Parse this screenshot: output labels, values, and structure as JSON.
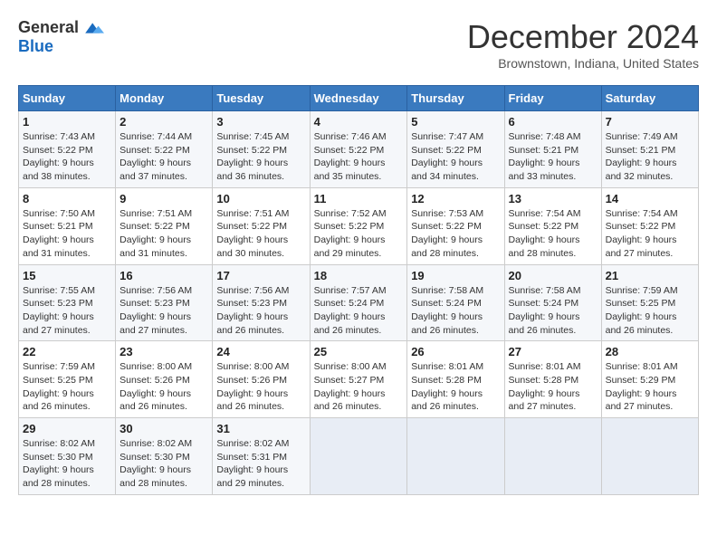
{
  "header": {
    "logo_general": "General",
    "logo_blue": "Blue",
    "month_title": "December 2024",
    "location": "Brownstown, Indiana, United States"
  },
  "weekdays": [
    "Sunday",
    "Monday",
    "Tuesday",
    "Wednesday",
    "Thursday",
    "Friday",
    "Saturday"
  ],
  "weeks": [
    [
      {
        "day": "1",
        "sunrise": "7:43 AM",
        "sunset": "5:22 PM",
        "daylight": "9 hours and 38 minutes."
      },
      {
        "day": "2",
        "sunrise": "7:44 AM",
        "sunset": "5:22 PM",
        "daylight": "9 hours and 37 minutes."
      },
      {
        "day": "3",
        "sunrise": "7:45 AM",
        "sunset": "5:22 PM",
        "daylight": "9 hours and 36 minutes."
      },
      {
        "day": "4",
        "sunrise": "7:46 AM",
        "sunset": "5:22 PM",
        "daylight": "9 hours and 35 minutes."
      },
      {
        "day": "5",
        "sunrise": "7:47 AM",
        "sunset": "5:22 PM",
        "daylight": "9 hours and 34 minutes."
      },
      {
        "day": "6",
        "sunrise": "7:48 AM",
        "sunset": "5:21 PM",
        "daylight": "9 hours and 33 minutes."
      },
      {
        "day": "7",
        "sunrise": "7:49 AM",
        "sunset": "5:21 PM",
        "daylight": "9 hours and 32 minutes."
      }
    ],
    [
      {
        "day": "8",
        "sunrise": "7:50 AM",
        "sunset": "5:21 PM",
        "daylight": "9 hours and 31 minutes."
      },
      {
        "day": "9",
        "sunrise": "7:51 AM",
        "sunset": "5:22 PM",
        "daylight": "9 hours and 31 minutes."
      },
      {
        "day": "10",
        "sunrise": "7:51 AM",
        "sunset": "5:22 PM",
        "daylight": "9 hours and 30 minutes."
      },
      {
        "day": "11",
        "sunrise": "7:52 AM",
        "sunset": "5:22 PM",
        "daylight": "9 hours and 29 minutes."
      },
      {
        "day": "12",
        "sunrise": "7:53 AM",
        "sunset": "5:22 PM",
        "daylight": "9 hours and 28 minutes."
      },
      {
        "day": "13",
        "sunrise": "7:54 AM",
        "sunset": "5:22 PM",
        "daylight": "9 hours and 28 minutes."
      },
      {
        "day": "14",
        "sunrise": "7:54 AM",
        "sunset": "5:22 PM",
        "daylight": "9 hours and 27 minutes."
      }
    ],
    [
      {
        "day": "15",
        "sunrise": "7:55 AM",
        "sunset": "5:23 PM",
        "daylight": "9 hours and 27 minutes."
      },
      {
        "day": "16",
        "sunrise": "7:56 AM",
        "sunset": "5:23 PM",
        "daylight": "9 hours and 27 minutes."
      },
      {
        "day": "17",
        "sunrise": "7:56 AM",
        "sunset": "5:23 PM",
        "daylight": "9 hours and 26 minutes."
      },
      {
        "day": "18",
        "sunrise": "7:57 AM",
        "sunset": "5:24 PM",
        "daylight": "9 hours and 26 minutes."
      },
      {
        "day": "19",
        "sunrise": "7:58 AM",
        "sunset": "5:24 PM",
        "daylight": "9 hours and 26 minutes."
      },
      {
        "day": "20",
        "sunrise": "7:58 AM",
        "sunset": "5:24 PM",
        "daylight": "9 hours and 26 minutes."
      },
      {
        "day": "21",
        "sunrise": "7:59 AM",
        "sunset": "5:25 PM",
        "daylight": "9 hours and 26 minutes."
      }
    ],
    [
      {
        "day": "22",
        "sunrise": "7:59 AM",
        "sunset": "5:25 PM",
        "daylight": "9 hours and 26 minutes."
      },
      {
        "day": "23",
        "sunrise": "8:00 AM",
        "sunset": "5:26 PM",
        "daylight": "9 hours and 26 minutes."
      },
      {
        "day": "24",
        "sunrise": "8:00 AM",
        "sunset": "5:26 PM",
        "daylight": "9 hours and 26 minutes."
      },
      {
        "day": "25",
        "sunrise": "8:00 AM",
        "sunset": "5:27 PM",
        "daylight": "9 hours and 26 minutes."
      },
      {
        "day": "26",
        "sunrise": "8:01 AM",
        "sunset": "5:28 PM",
        "daylight": "9 hours and 26 minutes."
      },
      {
        "day": "27",
        "sunrise": "8:01 AM",
        "sunset": "5:28 PM",
        "daylight": "9 hours and 27 minutes."
      },
      {
        "day": "28",
        "sunrise": "8:01 AM",
        "sunset": "5:29 PM",
        "daylight": "9 hours and 27 minutes."
      }
    ],
    [
      {
        "day": "29",
        "sunrise": "8:02 AM",
        "sunset": "5:30 PM",
        "daylight": "9 hours and 28 minutes."
      },
      {
        "day": "30",
        "sunrise": "8:02 AM",
        "sunset": "5:30 PM",
        "daylight": "9 hours and 28 minutes."
      },
      {
        "day": "31",
        "sunrise": "8:02 AM",
        "sunset": "5:31 PM",
        "daylight": "9 hours and 29 minutes."
      },
      null,
      null,
      null,
      null
    ]
  ]
}
